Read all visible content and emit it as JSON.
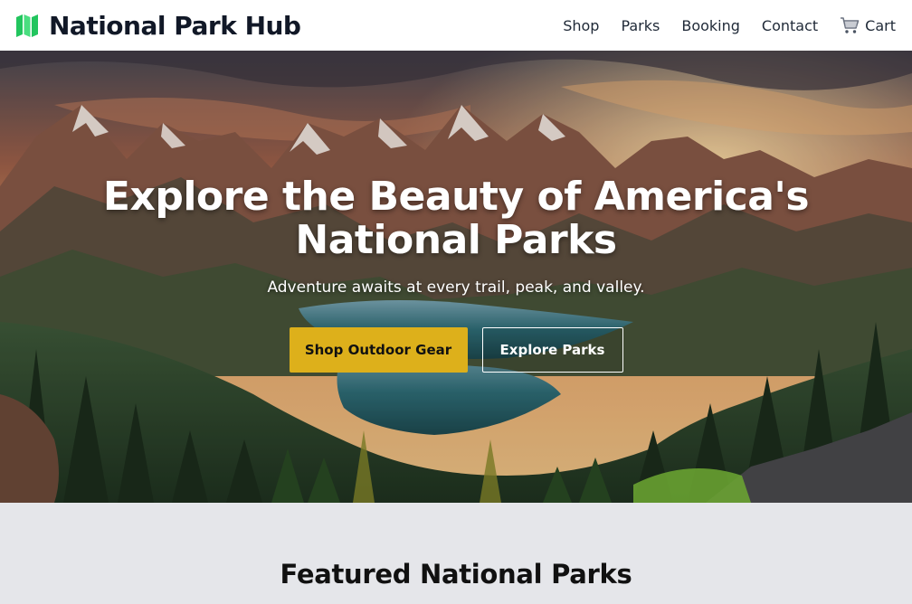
{
  "header": {
    "brand_name": "National Park Hub",
    "brand_icon": "map-icon",
    "nav": {
      "shop": "Shop",
      "parks": "Parks",
      "booking": "Booking",
      "contact": "Contact",
      "cart": "Cart",
      "cart_icon": "cart-icon"
    }
  },
  "hero": {
    "title": "Explore the Beauty of America's National Parks",
    "subtitle": "Adventure awaits at every trail, peak, and valley.",
    "primary_button": "Shop Outdoor Gear",
    "secondary_button": "Explore Parks",
    "image_subject": "mountain-lake-forest-sunset"
  },
  "featured": {
    "title": "Featured National Parks"
  },
  "colors": {
    "brand_icon": "#22c55e",
    "primary_button": "#ddb01b",
    "section_background": "#e5e6ea",
    "header_background": "#ffffff"
  }
}
